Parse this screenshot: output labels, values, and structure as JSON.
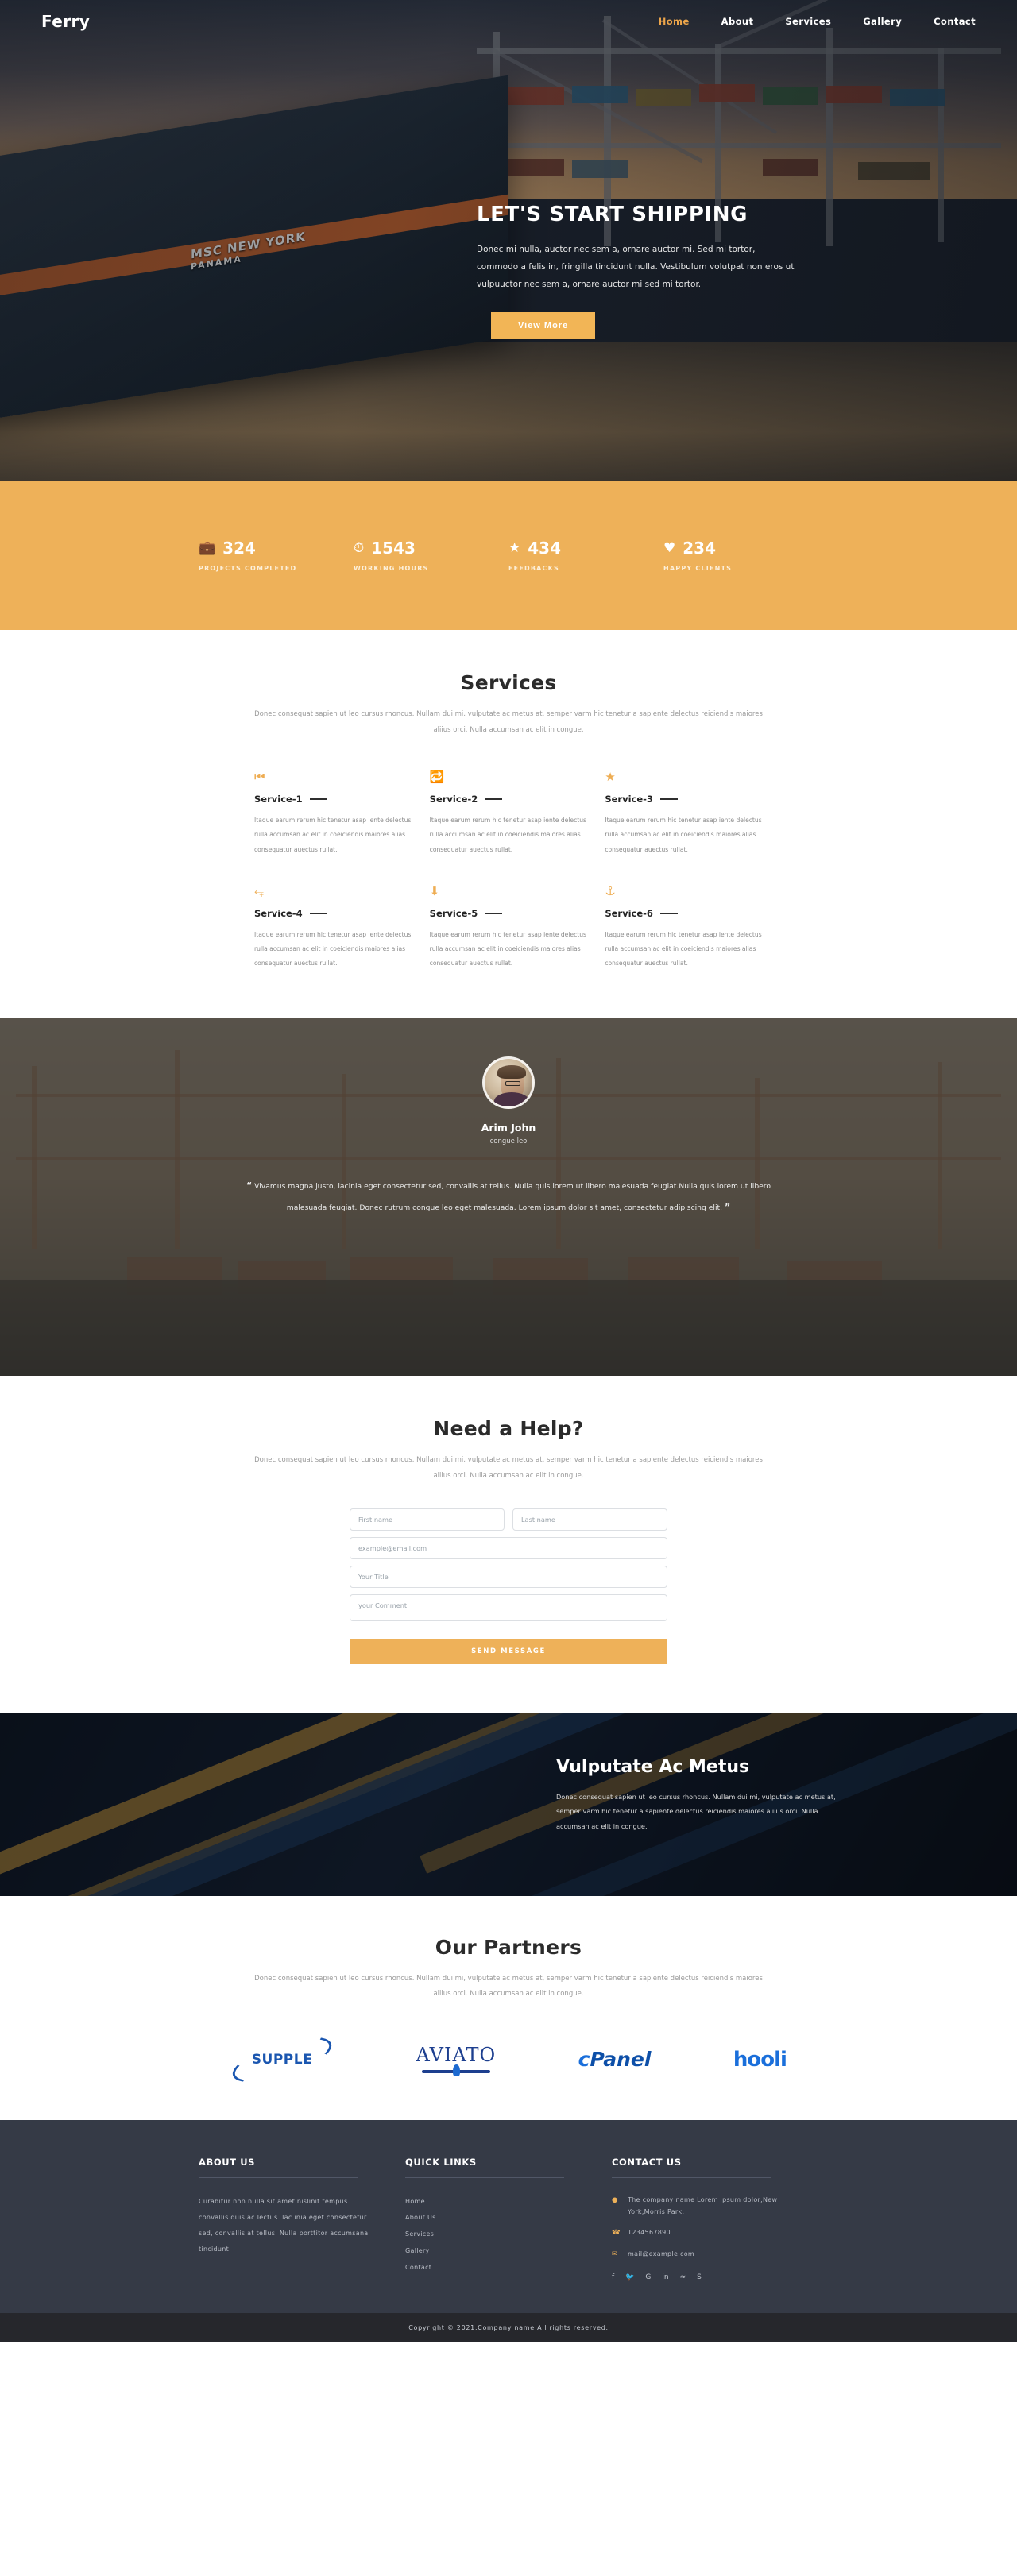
{
  "nav": {
    "brand": "Ferry",
    "links": [
      {
        "label": "Home",
        "active": true
      },
      {
        "label": "About",
        "active": false
      },
      {
        "label": "Services",
        "active": false
      },
      {
        "label": "Gallery",
        "active": false
      },
      {
        "label": "Contact",
        "active": false
      }
    ]
  },
  "hero": {
    "title": "LET'S START SHIPPING",
    "desc": "Donec mi nulla, auctor nec sem a, ornare auctor mi. Sed mi tortor, commodo a felis in, fringilla tincidunt nulla. Vestibulum volutpat non eros ut vulpuuctor nec sem a, ornare auctor mi sed mi tortor.",
    "button": "View More",
    "ship_name": "MSC NEW YORK",
    "ship_port": "PANAMA"
  },
  "stats": [
    {
      "icon": "briefcase-icon",
      "glyph": "Ὃc",
      "value": "324",
      "label": "PROJECTS COMPLETED"
    },
    {
      "icon": "clock-icon",
      "glyph": "⏱",
      "value": "1543",
      "label": "WORKING HOURS"
    },
    {
      "icon": "star-icon",
      "glyph": "★",
      "value": "434",
      "label": "FEEDBACKS"
    },
    {
      "icon": "heart-icon",
      "glyph": "♥",
      "value": "234",
      "label": "HAPPY CLIENTS"
    }
  ],
  "services": {
    "title": "Services",
    "subtitle": "Donec consequat sapien ut leo cursus rhoncus. Nullam dui mi, vulputate ac metus at, semper varm hic tenetur a sapiente delectus reiciendis maiores aliius orci. Nulla accumsan ac elit in congue.",
    "items": [
      {
        "icon": "fast-backward-icon",
        "glyph": "⏮",
        "name": "Service-1",
        "text": "Itaque earum rerum hic tenetur asap iente delectus rulla accumsan ac elit in coeiciendis maiores alias consequatur auectus rullat."
      },
      {
        "icon": "share-square-icon",
        "glyph": "↪",
        "name": "Service-2",
        "text": "Itaque earum rerum hic tenetur asap iente delectus rulla accumsan ac elit in coeiciendis maiores alias consequatur auectus rullat."
      },
      {
        "icon": "star-icon",
        "glyph": "★",
        "name": "Service-3",
        "text": "Itaque earum rerum hic tenetur asap iente delectus rulla accumsan ac elit in coeiciendis maiores alias consequatur auectus rullat."
      },
      {
        "icon": "expand-arrows-icon",
        "glyph": "⤢",
        "name": "Service-4",
        "text": "Itaque earum rerum hic tenetur asap iente delectus rulla accumsan ac elit in coeiciendis maiores alias consequatur auectus rullat."
      },
      {
        "icon": "arrow-circle-down-icon",
        "glyph": "⬇",
        "name": "Service-5",
        "text": "Itaque earum rerum hic tenetur asap iente delectus rulla accumsan ac elit in coeiciendis maiores alias consequatur auectus rullat."
      },
      {
        "icon": "anchor-icon",
        "glyph": "⚓",
        "name": "Service-6",
        "text": "Itaque earum rerum hic tenetur asap iente delectus rulla accumsan ac elit in coeiciendis maiores alias consequatur auectus rullat."
      }
    ]
  },
  "testimonial": {
    "name": "Arim John",
    "role": "congue leo",
    "quote": "Vivamus magna justo, lacinia eget consectetur sed, convallis at tellus. Nulla quis lorem ut libero malesuada feugiat.Nulla quis lorem ut libero malesuada feugiat. Donec rutrum congue leo eget malesuada. Lorem ipsum dolor sit amet, consectetur adipiscing elit.",
    "quote_open": "“",
    "quote_close": "”"
  },
  "contact_form": {
    "title": "Need a Help?",
    "subtitle": "Donec consequat sapien ut leo cursus rhoncus. Nullam dui mi, vulputate ac metus at, semper varm hic tenetur a sapiente delectus reiciendis maiores aliius orci. Nulla accumsan ac elit in congue.",
    "first_name_placeholder": "First name",
    "last_name_placeholder": "Last name",
    "email_placeholder": "example@email.com",
    "title_placeholder": "Your Title",
    "comment_placeholder": "your Comment",
    "submit_label": "SEND MESSAGE"
  },
  "vulputate": {
    "title": "Vulputate Ac Metus",
    "text": "Donec consequat sapien ut leo cursus rhoncus. Nullam dui mi, vulputate ac metus at, semper varm hic tenetur a sapiente delectus reiciendis maiores aliius orci. Nulla accumsan ac elit in congue."
  },
  "partners": {
    "title": "Our Partners",
    "subtitle": "Donec consequat sapien ut leo cursus rhoncus. Nullam dui mi, vulputate ac metus at, semper varm hic tenetur a sapiente delectus reiciendis maiores aliius orci. Nulla accumsan ac elit in congue.",
    "logos": [
      {
        "name": "SUPPLE"
      },
      {
        "name": "AVIATO"
      },
      {
        "name": "cPanel",
        "part1": "c",
        "part2": "Panel"
      },
      {
        "name": "hooli"
      }
    ]
  },
  "footer": {
    "about": {
      "heading": "ABOUT US",
      "text": "Curabitur non nulla sit amet nislinit tempus convallis quis ac lectus. lac inia eget consectetur sed, convallis at tellus. Nulla porttitor accumsana tincidunt."
    },
    "quick_links": {
      "heading": "QUICK LINKS",
      "items": [
        "Home",
        "About Us",
        "Services",
        "Gallery",
        "Contact"
      ]
    },
    "contact": {
      "heading": "CONTACT US",
      "address": "The company name Lorem ipsum dolor,New York,Morris Park.",
      "phone": "1234567890",
      "email": "mail@example.com",
      "socials": [
        {
          "icon": "facebook-icon",
          "glyph": "f"
        },
        {
          "icon": "twitter-icon",
          "glyph": "ᵗ"
        },
        {
          "icon": "google-plus-icon",
          "glyph": "G"
        },
        {
          "icon": "linkedin-icon",
          "glyph": "in"
        },
        {
          "icon": "rss-icon",
          "glyph": "≋"
        },
        {
          "icon": "skype-icon",
          "glyph": "S"
        }
      ]
    },
    "copyright": "Copyright © 2021.Company name All rights reserved."
  }
}
